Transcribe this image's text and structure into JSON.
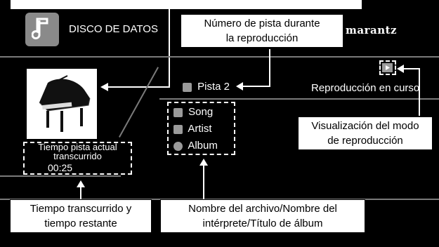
{
  "header": {
    "source_label": "DISCO DE DATOS",
    "brand": "marantz"
  },
  "track": {
    "number_label": "Pista 2",
    "status": "Reproducción en curso"
  },
  "metadata": {
    "song": "Song",
    "artist": "Artist",
    "album": "Album"
  },
  "time": {
    "label_line1": "Tiempo pista actual",
    "label_line2": "transcurrido",
    "value": "00:25"
  },
  "callouts": {
    "track_number_line1": "Número de pista durante",
    "track_number_line2": "la reproducción",
    "play_mode_line1": "Visualización del modo",
    "play_mode_line2": "de reproducción",
    "time_line1": "Tiempo transcurrido y",
    "time_line2": "tiempo restante",
    "names_line1": "Nombre del archivo/Nombre del",
    "names_line2": "intérprete/Título de álbum"
  },
  "icons": {
    "source": "music-note-icon",
    "play_mode": "play-icon",
    "artwork": "grand-piano-artwork"
  }
}
